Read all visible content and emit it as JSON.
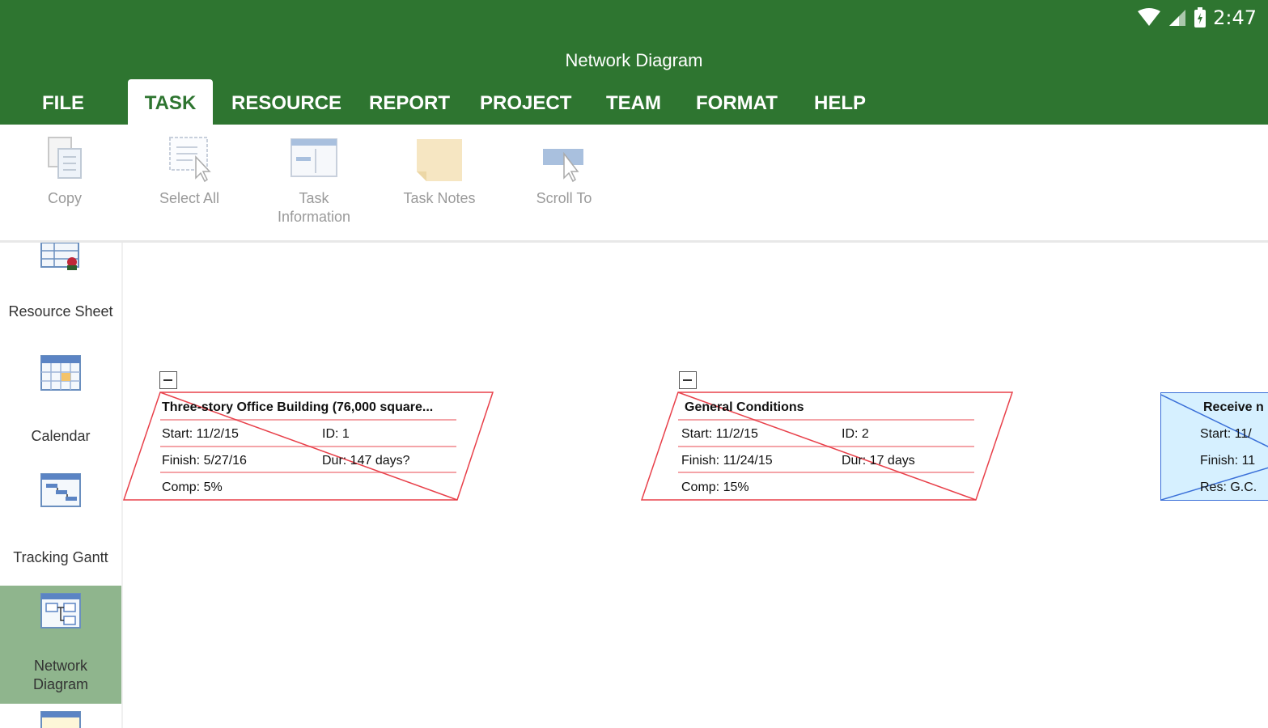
{
  "status": {
    "time": "2:47"
  },
  "app": {
    "title": "Network Diagram"
  },
  "tabs": [
    {
      "label": "FILE"
    },
    {
      "label": "TASK",
      "active": true
    },
    {
      "label": "RESOURCE"
    },
    {
      "label": "REPORT"
    },
    {
      "label": "PROJECT"
    },
    {
      "label": "TEAM"
    },
    {
      "label": "FORMAT"
    },
    {
      "label": "HELP"
    }
  ],
  "ribbon": {
    "copy": "Copy",
    "select_all": "Select All",
    "task_information_1": "Task",
    "task_information_2": "Information",
    "task_notes": "Task Notes",
    "scroll_to": "Scroll To"
  },
  "nav": {
    "resource_sheet": "Resource Sheet",
    "calendar": "Calendar",
    "tracking_gantt": "Tracking Gantt",
    "network_diagram_1": "Network",
    "network_diagram_2": "Diagram"
  },
  "nodes": [
    {
      "title": "Three-story Office Building (76,000 square...",
      "start": "Start:  11/2/15",
      "id": "ID:  1",
      "finish": "Finish:  5/27/16",
      "dur": "Dur:  147 days?",
      "comp": "Comp:  5%"
    },
    {
      "title": "General Conditions",
      "start": "Start:  11/2/15",
      "id": "ID:  2",
      "finish": "Finish:  11/24/15",
      "dur": "Dur:  17 days",
      "comp": "Comp:  15%"
    },
    {
      "title": "Receive n",
      "start": "Start:  11/",
      "finish": "Finish:  11",
      "res": "Res:  G.C."
    }
  ],
  "colors": {
    "brand_green": "#2e7530",
    "nav_active": "#8fb58d",
    "summary_outline": "#e8404a",
    "task_fill": "#d6f0ff",
    "task_outline": "#3a6fd8"
  }
}
